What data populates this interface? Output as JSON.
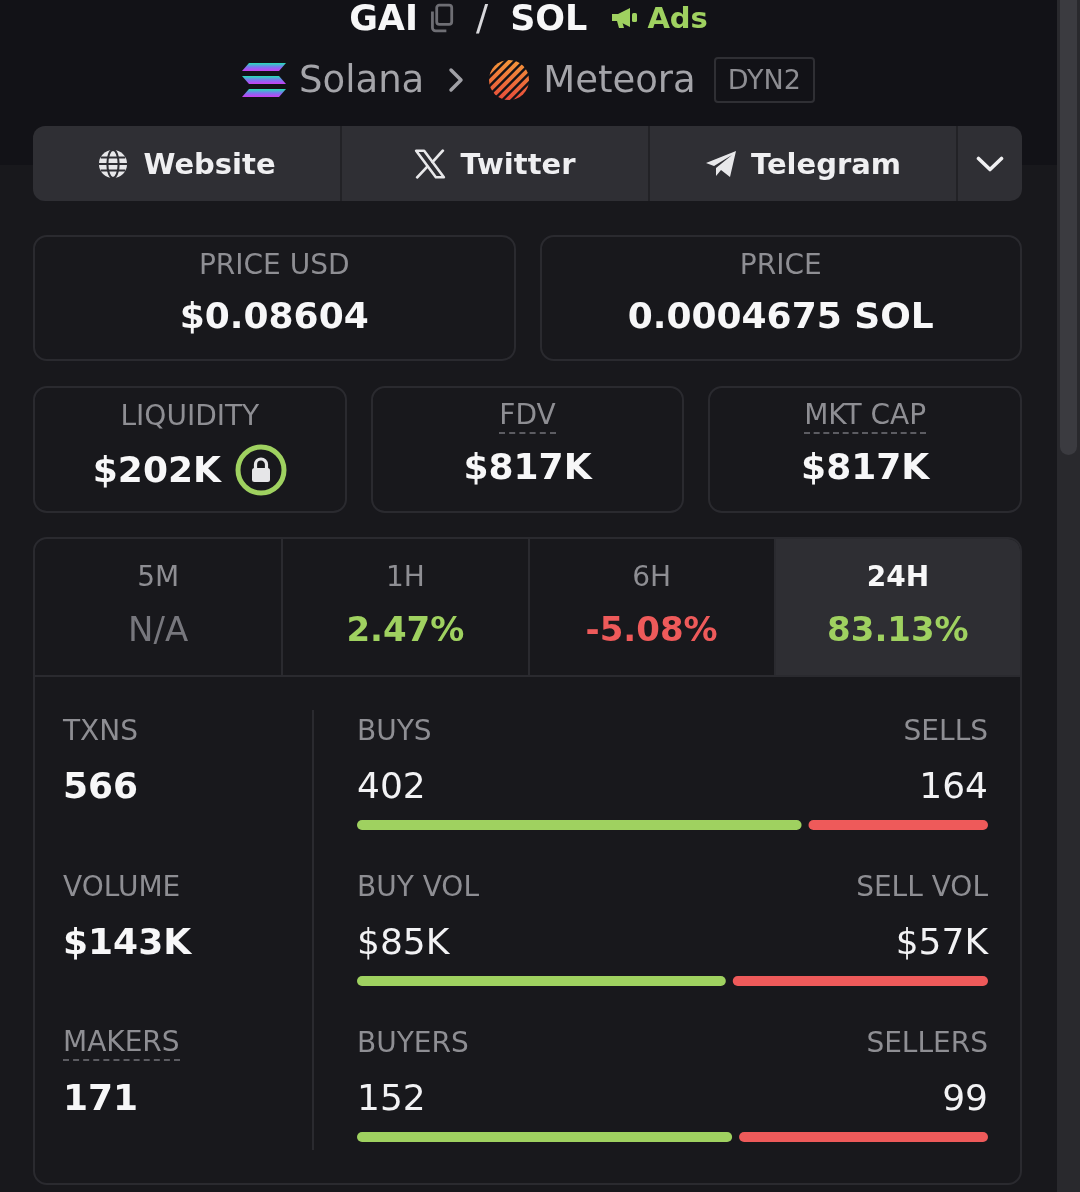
{
  "pair": {
    "base": "GAI",
    "separator": "/",
    "quote": "SOL",
    "ads_label": "Ads"
  },
  "route": {
    "chain": "Solana",
    "dex": "Meteora",
    "pool_type": "DYN2"
  },
  "links": [
    {
      "label": "Website"
    },
    {
      "label": "Twitter"
    },
    {
      "label": "Telegram"
    }
  ],
  "prices": [
    {
      "label": "PRICE USD",
      "value": "$0.08604"
    },
    {
      "label": "PRICE",
      "value": "0.0004675 SOL"
    }
  ],
  "metrics": [
    {
      "label": "LIQUIDITY",
      "value": "$202K",
      "locked": true,
      "underlined": false
    },
    {
      "label": "FDV",
      "value": "$817K",
      "locked": false,
      "underlined": true
    },
    {
      "label": "MKT CAP",
      "value": "$817K",
      "locked": false,
      "underlined": true
    }
  ],
  "timeframes": [
    {
      "label": "5M",
      "change": "N/A",
      "kind": "none",
      "selected": false
    },
    {
      "label": "1H",
      "change": "2.47%",
      "kind": "up",
      "selected": false
    },
    {
      "label": "6H",
      "change": "-5.08%",
      "kind": "down",
      "selected": false
    },
    {
      "label": "24H",
      "change": "83.13%",
      "kind": "up",
      "selected": true
    }
  ],
  "stats": [
    {
      "label": "TXNS",
      "value": "566",
      "underlined": false,
      "buy_label": "BUYS",
      "buy_value": "402",
      "sell_label": "SELLS",
      "sell_value": "164",
      "level": 0.71
    },
    {
      "label": "VOLUME",
      "value": "$143K",
      "underlined": false,
      "buy_label": "BUY VOL",
      "buy_value": "$85K",
      "sell_label": "SELL VOL",
      "sell_value": "$57K",
      "level": 0.59
    },
    {
      "label": "MAKERS",
      "value": "171",
      "underlined": true,
      "buy_label": "BUYERS",
      "buy_value": "152",
      "sell_label": "SELLERS",
      "sell_value": "99",
      "level": 0.6
    }
  ]
}
